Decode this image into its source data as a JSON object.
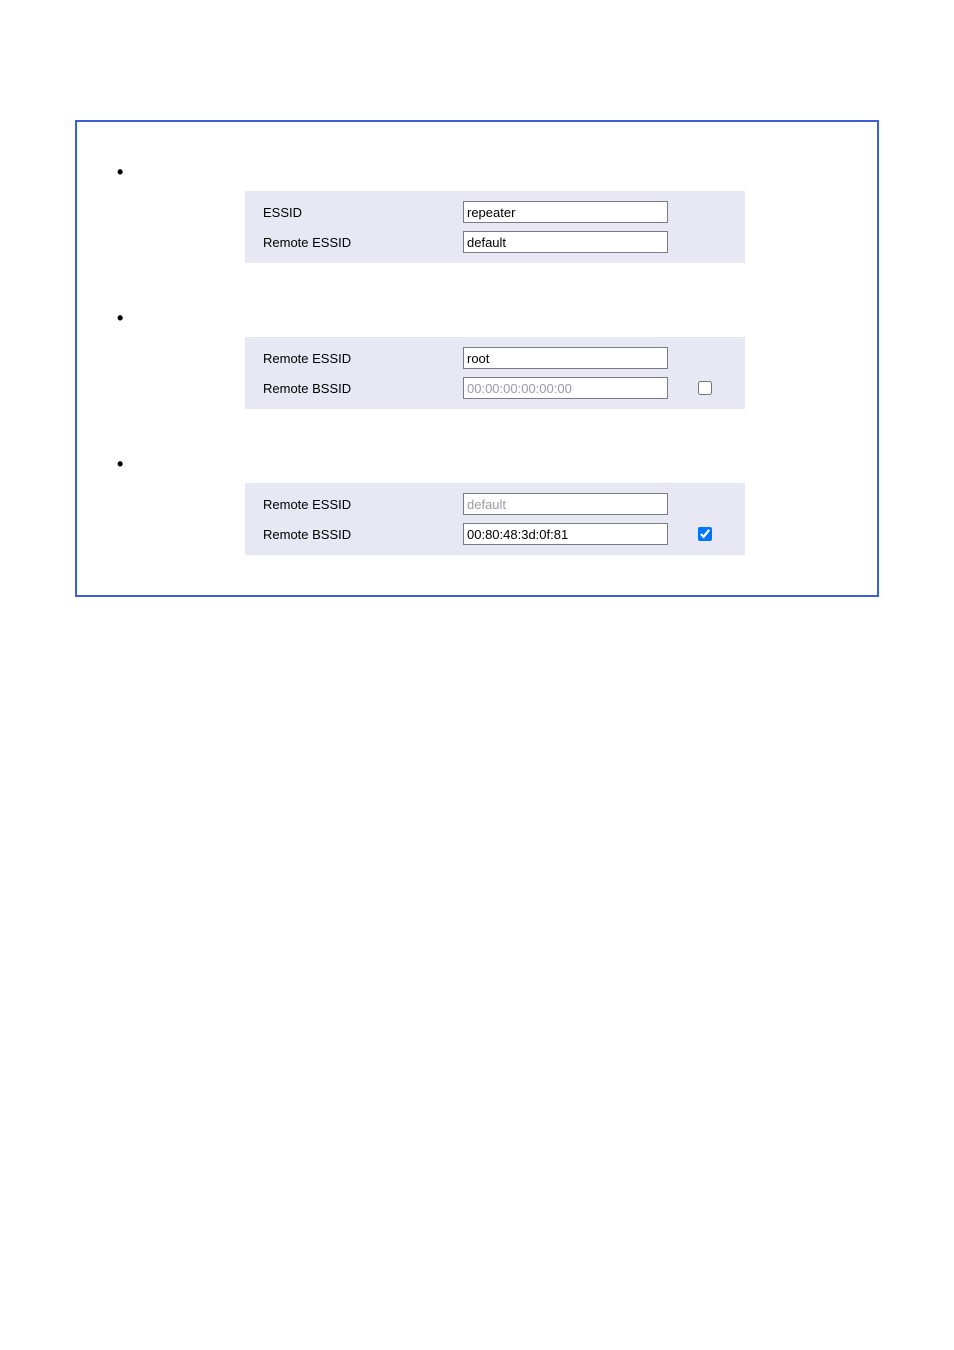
{
  "sections": [
    {
      "rows": [
        {
          "label": "ESSID",
          "value": "repeater",
          "disabled": false,
          "hasCheckbox": false
        },
        {
          "label": "Remote ESSID",
          "value": "default",
          "disabled": false,
          "hasCheckbox": false
        }
      ]
    },
    {
      "rows": [
        {
          "label": "Remote ESSID",
          "value": "root",
          "disabled": false,
          "hasCheckbox": false
        },
        {
          "label": "Remote BSSID",
          "value": "00:00:00:00:00:00",
          "disabled": true,
          "hasCheckbox": true,
          "checked": false
        }
      ]
    },
    {
      "rows": [
        {
          "label": "Remote ESSID",
          "value": "default",
          "disabled": true,
          "hasCheckbox": false
        },
        {
          "label": "Remote BSSID",
          "value": "00:80:48:3d:0f:81",
          "disabled": false,
          "hasCheckbox": true,
          "checked": true
        }
      ]
    }
  ]
}
